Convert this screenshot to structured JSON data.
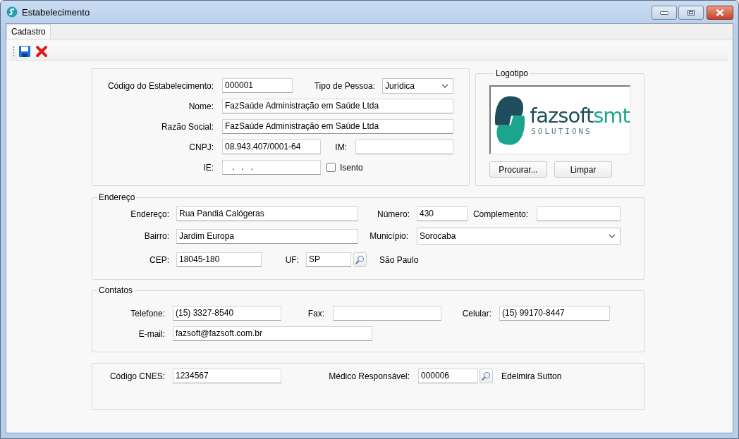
{
  "window": {
    "title": "Estabelecimento"
  },
  "tabs": [
    {
      "label": "Cadastro",
      "selected": true
    }
  ],
  "general": {
    "codigo": {
      "label": "Código do Estabelecimento:",
      "value": "000001"
    },
    "tipo_pessoa": {
      "label": "Tipo de Pessoa:",
      "value": "Jurídica"
    },
    "nome": {
      "label": "Nome:",
      "value": "FazSaúde Administração em Saúde Ltda"
    },
    "razao_social": {
      "label": "Razão Social:",
      "value": "FazSaúde Administração em Saúde Ltda"
    },
    "cnpj": {
      "label": "CNPJ:",
      "value": "08.943.407/0001-64"
    },
    "im": {
      "label": "IM:"
    },
    "ie": {
      "label": "IE:",
      "value": "   .   .   ."
    },
    "isento": {
      "label": "Isento",
      "checked": false
    }
  },
  "logo": {
    "title": "Logotipo",
    "wordmark": [
      {
        "text": "fazsoft",
        "color": "#1f4d5e"
      },
      {
        "text": "smt",
        "color": "#1aa58c"
      }
    ],
    "tagline": "SOLUTIONS",
    "buttons": [
      "Procurar...",
      "Limpar"
    ]
  },
  "endereco": {
    "title": "Endereço",
    "endereco": {
      "label": "Endereço:",
      "value": "Rua Pandiá Calógeras"
    },
    "numero": {
      "label": "Número:",
      "value": "430"
    },
    "complemento": {
      "label": "Complemento:"
    },
    "bairro": {
      "label": "Bairro:",
      "value": "Jardim Europa"
    },
    "municipio": {
      "label": "Município:",
      "value": "Sorocaba"
    },
    "cep": {
      "label": "CEP:",
      "value": "18045-180"
    },
    "uf": {
      "label": "UF:",
      "value": "SP"
    },
    "uf_name": "São Paulo"
  },
  "contatos": {
    "title": "Contatos",
    "telefone": {
      "label": "Telefone:",
      "value": "(15) 3327-8540"
    },
    "fax": {
      "label": "Fax:"
    },
    "celular": {
      "label": "Celular:",
      "value": "(15) 99170-8447"
    },
    "email": {
      "label": "E-mail:",
      "value": "fazsoft@fazsoft.com.br"
    }
  },
  "outros": {
    "cnes": {
      "label": "Código CNES:",
      "value": "1234567"
    },
    "medico": {
      "label": "Médico Responsável:",
      "value": "000006"
    },
    "medico_name": "Edelmira Sutton"
  }
}
